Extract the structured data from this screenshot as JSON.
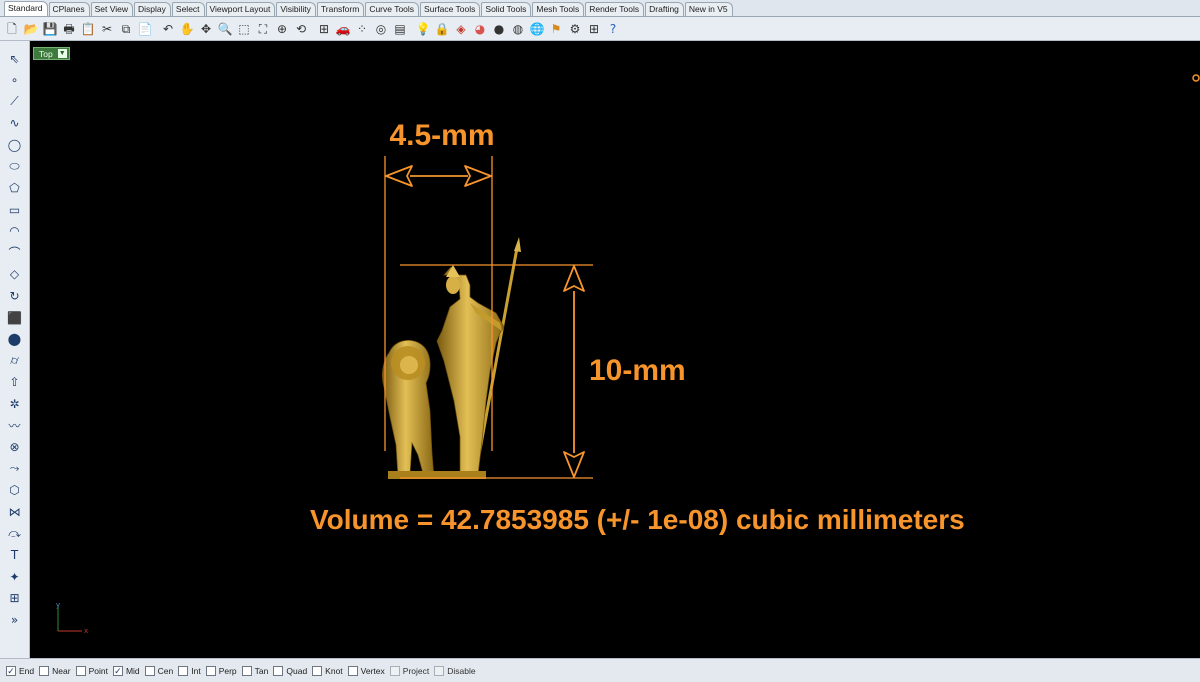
{
  "tabs": [
    "Standard",
    "CPlanes",
    "Set View",
    "Display",
    "Select",
    "Viewport Layout",
    "Visibility",
    "Transform",
    "Curve Tools",
    "Surface Tools",
    "Solid Tools",
    "Mesh Tools",
    "Render Tools",
    "Drafting",
    "New in V5"
  ],
  "active_tab": "Standard",
  "toolbar_icons": [
    "new-file-icon",
    "open-folder-icon",
    "save-icon",
    "print-icon",
    "import-icon",
    "cut-icon",
    "copy-icon",
    "paste-icon",
    "undo-icon",
    "pan-hand-icon",
    "move-cross-icon",
    "zoom-icon",
    "zoom-window-icon",
    "zoom-extents-icon",
    "zoom-selected-icon",
    "rotate-view-icon",
    "four-viewports-icon",
    "car-object-icon",
    "points-icon",
    "circle-select-icon",
    "layers-icon",
    "light-bulb-icon",
    "lock-icon",
    "material-icon",
    "color-wheel-icon",
    "shaded-sphere-icon",
    "rendered-sphere-icon",
    "render-globe-icon",
    "flag-icon",
    "settings-gears-icon",
    "grid-snap-icon",
    "help-icon"
  ],
  "left_icons": [
    "select-arrow-icon",
    "point-icon",
    "polyline-icon",
    "curve-icon",
    "circle-icon",
    "ellipse-icon",
    "polygon-icon",
    "rectangle-icon",
    "arc-icon",
    "fillet-icon",
    "surface-icon",
    "revolve-icon",
    "box-solid-icon",
    "sphere-solid-icon",
    "cylinder-solid-icon",
    "extrude-icon",
    "transform-gear-icon",
    "sweep-icon",
    "boolean-icon",
    "flow-icon",
    "mesh-icon",
    "network-icon",
    "blend-icon",
    "text-object-icon",
    "explode-icon",
    "array-icon",
    "more-tools-icon"
  ],
  "viewport": {
    "label": "Top",
    "axis_x": "x",
    "axis_y": "y"
  },
  "dimensions": {
    "width_label": "4.5-mm",
    "height_label": "10-mm",
    "volume_text": "Volume = 42.7853985 (+/- 1e-08) cubic millimeters"
  },
  "colors": {
    "accent_orange": "#f7952c",
    "statue_gold": "#c9a032",
    "viewport_label_green": "#3e7a3e"
  },
  "osnaps": [
    {
      "label": "End",
      "checked": true
    },
    {
      "label": "Near",
      "checked": false
    },
    {
      "label": "Point",
      "checked": false
    },
    {
      "label": "Mid",
      "checked": true
    },
    {
      "label": "Cen",
      "checked": false
    },
    {
      "label": "Int",
      "checked": false
    },
    {
      "label": "Perp",
      "checked": false
    },
    {
      "label": "Tan",
      "checked": false
    },
    {
      "label": "Quad",
      "checked": false
    },
    {
      "label": "Knot",
      "checked": false
    },
    {
      "label": "Vertex",
      "checked": false
    },
    {
      "label": "Project",
      "checked": false,
      "disabled": true
    },
    {
      "label": "Disable",
      "checked": false,
      "disabled": true
    }
  ]
}
